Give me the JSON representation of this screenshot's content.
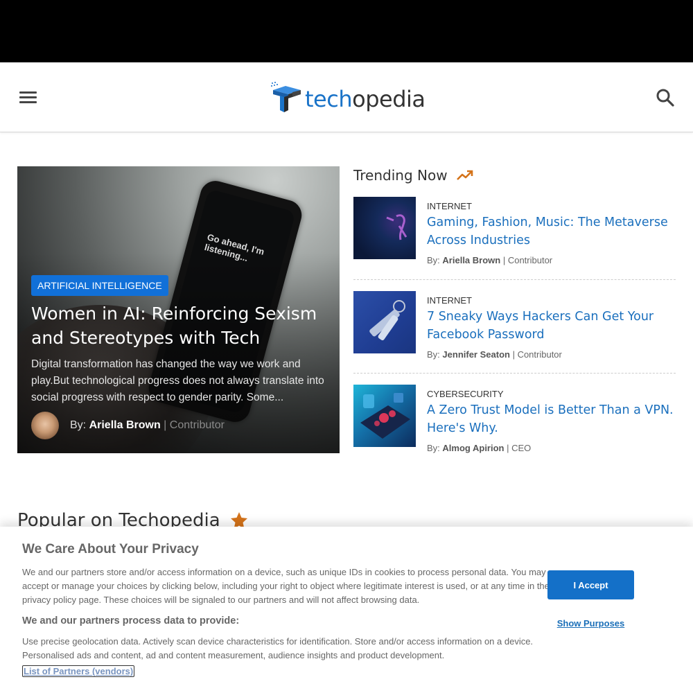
{
  "header": {
    "logo_part1": "tech",
    "logo_part2": "opedia",
    "menu_icon": "hamburger-icon",
    "search_icon": "search-icon"
  },
  "hero": {
    "category": "ARTIFICIAL INTELLIGENCE",
    "title": "Women in AI: Reinforcing Sexism and Stereotypes with Tech",
    "excerpt": "Digital transformation has changed the way we work and play.But technological progress does not always translate into social progress with respect to gender parity. Some...",
    "by_label": "By:",
    "author": "Ariella Brown",
    "separator": "|",
    "role": "Contributor",
    "phone_text": "Go ahead, I'm listening..."
  },
  "trending": {
    "title": "Trending Now",
    "icon": "trending-up-icon",
    "items": [
      {
        "category": "INTERNET",
        "title": "Gaming, Fashion, Music: The Metaverse Across Industries",
        "by_label": "By:",
        "author": "Ariella Brown",
        "role": "Contributor"
      },
      {
        "category": "INTERNET",
        "title": "7 Sneaky Ways Hackers Can Get Your Facebook Password",
        "by_label": "By:",
        "author": "Jennifer Seaton",
        "role": "Contributor"
      },
      {
        "category": "CYBERSECURITY",
        "title": "A Zero Trust Model is Better Than a VPN. Here's Why.",
        "by_label": "By:",
        "author": "Almog Apirion",
        "role": "CEO"
      }
    ]
  },
  "popular": {
    "title": "Popular on Techopedia",
    "icon": "star-icon"
  },
  "consent": {
    "title": "We Care About Your Privacy",
    "body": "We and our partners store and/or access information on a device, such as unique IDs in cookies to process personal data. You may accept or manage your choices by clicking below, including your right to object where legitimate interest is used, or at any time in the privacy policy page. These choices will be signaled to our partners and will not affect browsing data.",
    "subtitle": "We and our partners process data to provide:",
    "purposes": "Use precise geolocation data. Actively scan device characteristics for identification. Store and/or access information on a device. Personalised ads and content, ad and content measurement, audience insights and product development.",
    "partners_link": "List of Partners (vendors)",
    "accept_label": "I Accept",
    "show_purposes_label": "Show Purposes"
  },
  "colors": {
    "brand_blue": "#1a73c8",
    "link_blue": "#1a6fbd",
    "badge_blue": "#1170d8",
    "accent_orange": "#d4731a"
  }
}
